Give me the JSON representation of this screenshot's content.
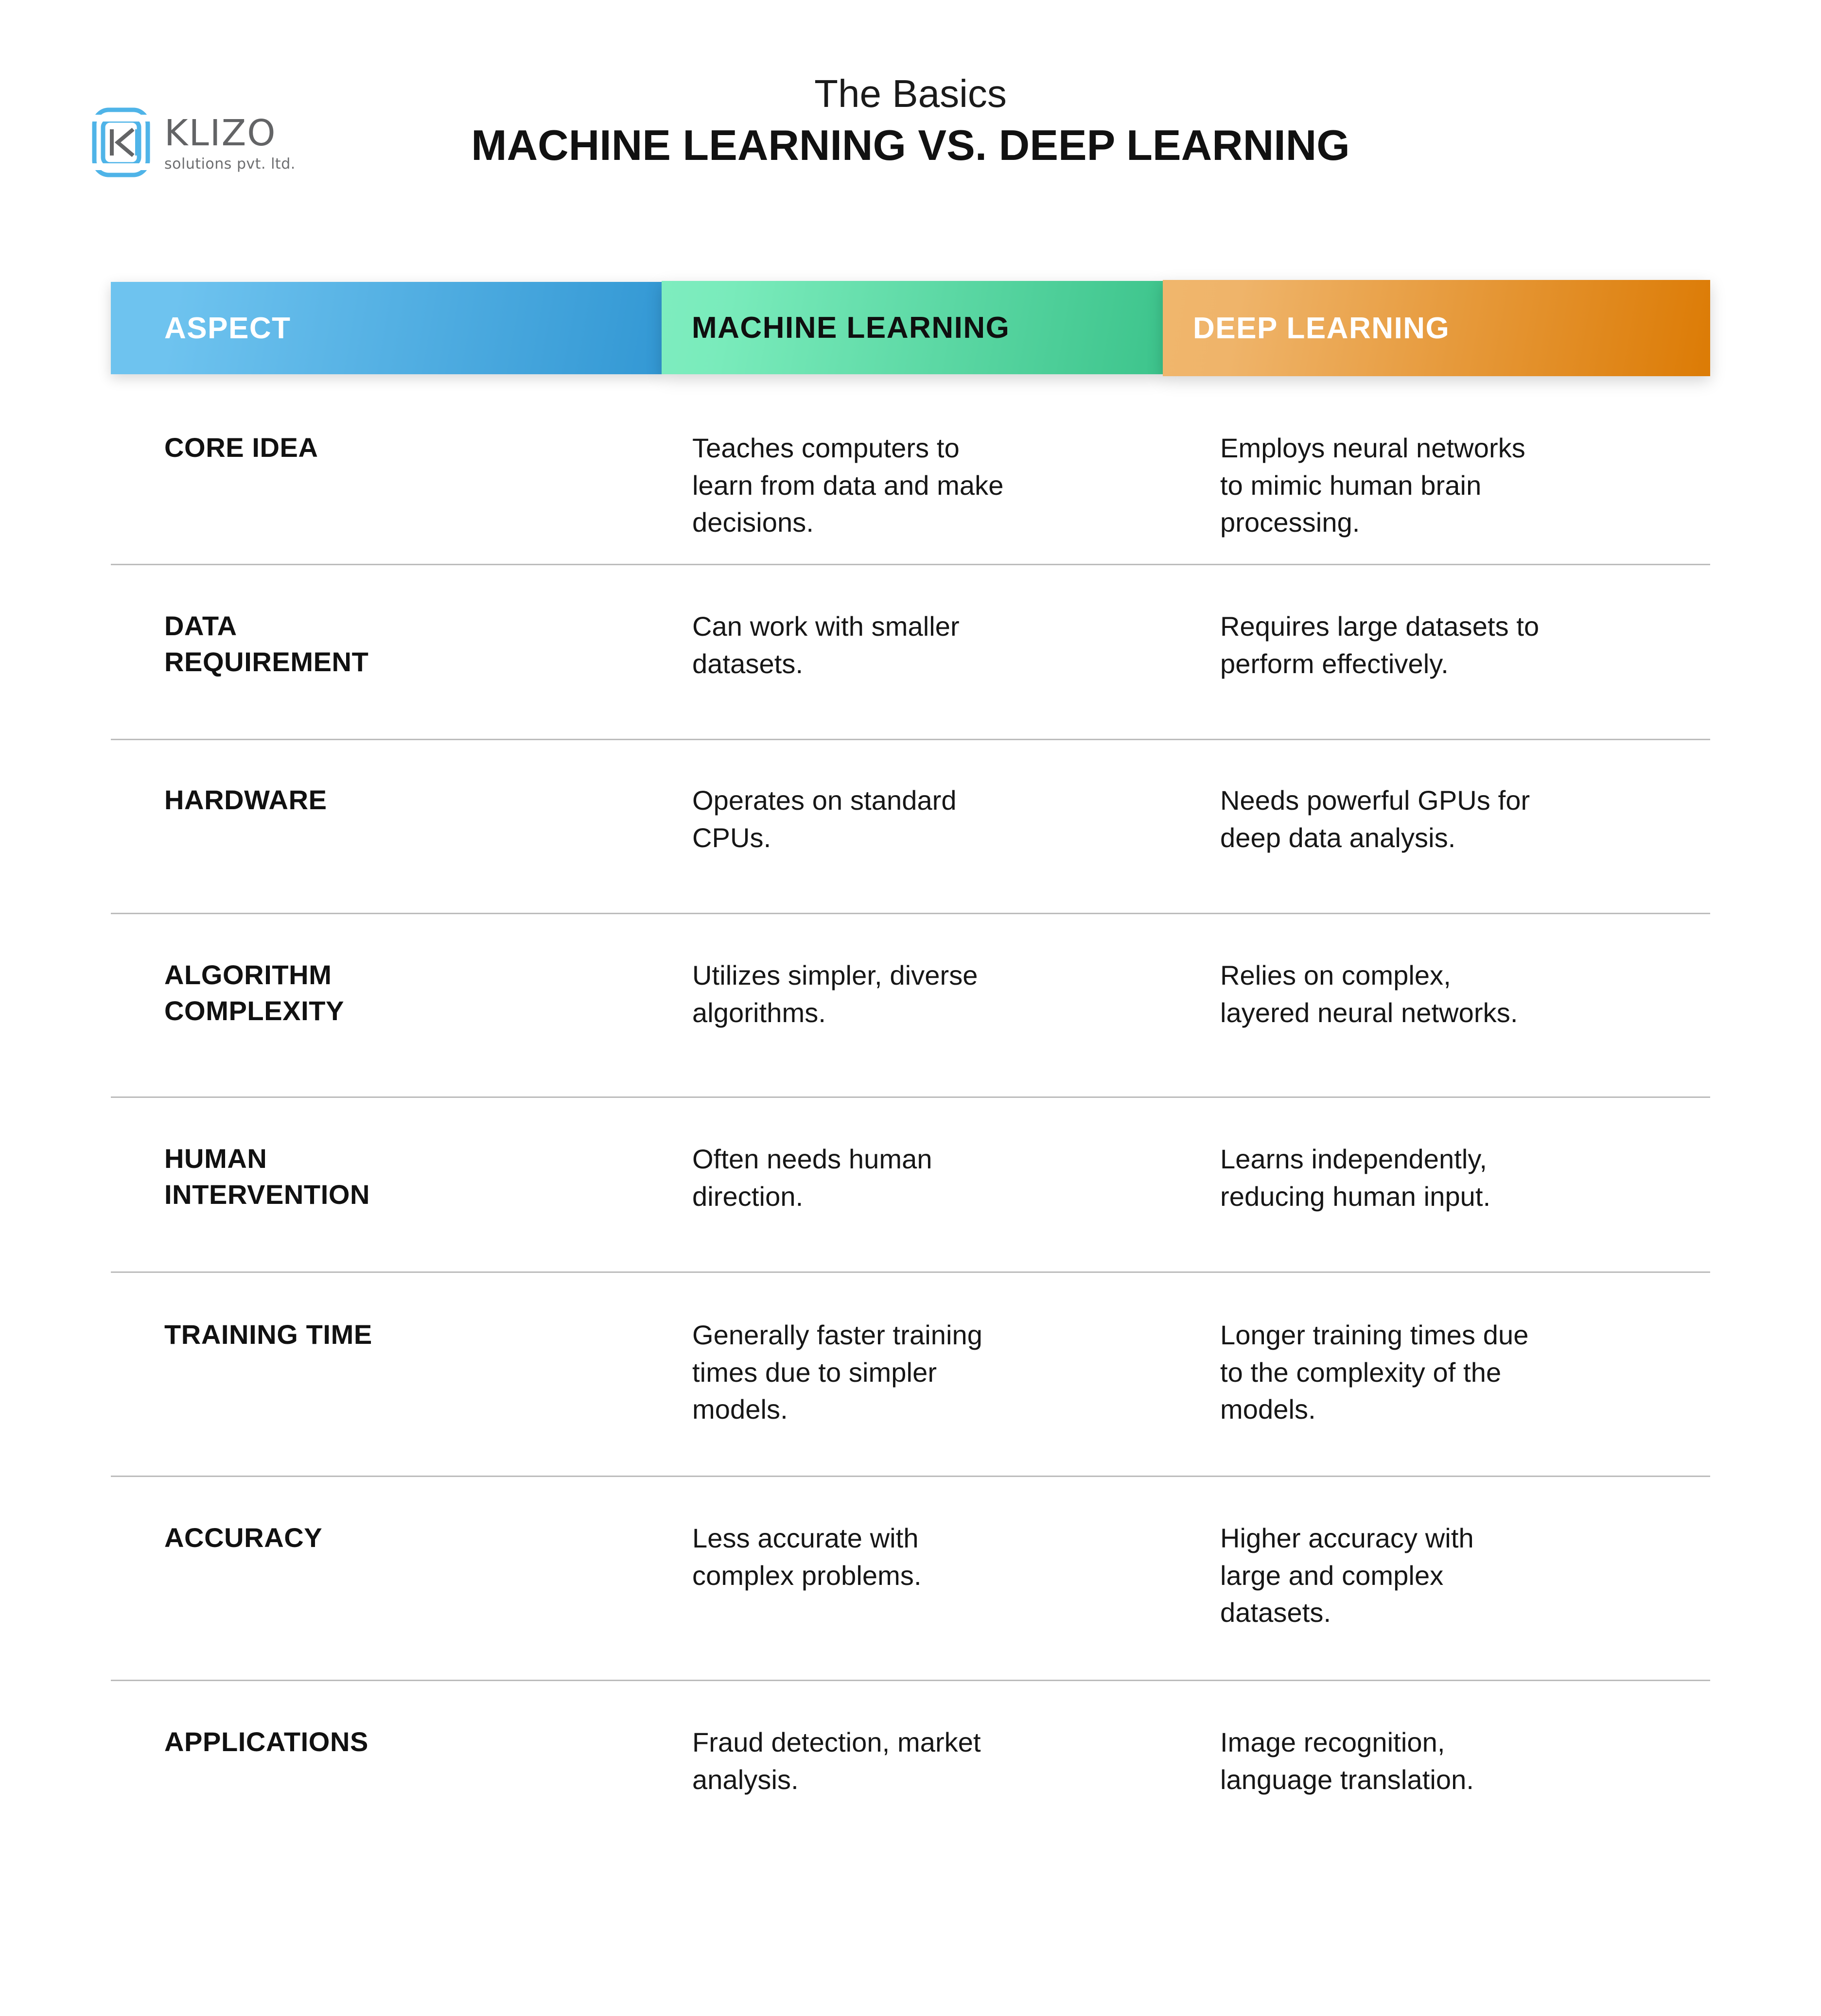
{
  "brand": {
    "logo_icon": "klizo-rounded-k-mark",
    "name": "KLIZO",
    "tagline": "solutions pvt. ltd.",
    "icon_color": "#4FB4E8",
    "name_color": "#636466"
  },
  "header": {
    "subtitle": "The Basics",
    "title": "MACHINE LEARNING VS. DEEP LEARNING"
  },
  "table": {
    "columns": [
      {
        "label": "ASPECT",
        "gradient_from": "#6EC3EF",
        "gradient_to": "#3398D4",
        "text_color": "#FFFFFF"
      },
      {
        "label": "MACHINE LEARNING",
        "gradient_from": "#7EEDBF",
        "gradient_to": "#3DC48C",
        "text_color": "#0F0F0F"
      },
      {
        "label": "DEEP LEARNING",
        "gradient_from": "#F0B66C",
        "gradient_to": "#DC7B05",
        "text_color": "#FFFFFF"
      }
    ],
    "divider_color": "#BCBCBC",
    "rows": [
      {
        "aspect": "CORE IDEA",
        "machine_learning": "Teaches computers to\nlearn from data and make\ndecisions.",
        "deep_learning": "Employs neural networks\nto mimic human brain\nprocessing."
      },
      {
        "aspect": "DATA\nREQUIREMENT",
        "machine_learning": "Can work with smaller\ndatasets.",
        "deep_learning": "Requires large datasets to\nperform effectively."
      },
      {
        "aspect": "HARDWARE",
        "machine_learning": "Operates on standard\nCPUs.",
        "deep_learning": "Needs powerful GPUs for\ndeep data analysis."
      },
      {
        "aspect": "ALGORITHM\nCOMPLEXITY",
        "machine_learning": "Utilizes simpler, diverse\nalgorithms.",
        "deep_learning": "Relies on complex,\nlayered neural networks."
      },
      {
        "aspect": "HUMAN\nINTERVENTION",
        "machine_learning": "Often needs human\ndirection.",
        "deep_learning": "Learns independently,\nreducing human input."
      },
      {
        "aspect": "TRAINING TIME",
        "machine_learning": "Generally faster training\ntimes due to simpler\nmodels.",
        "deep_learning": "Longer training times due\nto the complexity of the\nmodels."
      },
      {
        "aspect": "ACCURACY",
        "machine_learning": "Less accurate with\ncomplex problems.",
        "deep_learning": "Higher accuracy with\nlarge and complex\ndatasets."
      },
      {
        "aspect": "APPLICATIONS",
        "machine_learning": "Fraud detection, market\nanalysis.",
        "deep_learning": "Image recognition,\nlanguage translation."
      }
    ]
  }
}
